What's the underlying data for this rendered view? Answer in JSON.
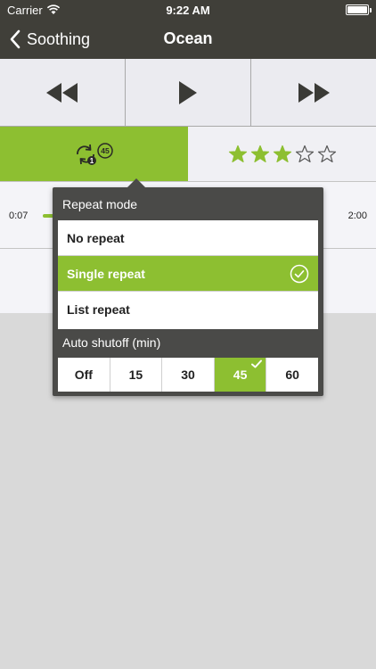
{
  "status": {
    "carrier": "Carrier",
    "time": "9:22 AM"
  },
  "nav": {
    "back_label": "Soothing",
    "title": "Ocean"
  },
  "controls": {
    "icons": [
      "rewind-icon",
      "play-icon",
      "fast-forward-icon"
    ]
  },
  "repeat": {
    "single_badge": "1",
    "minutes_badge": "45"
  },
  "rating": {
    "value": 3,
    "max": 5
  },
  "progress": {
    "elapsed": "0:07",
    "total": "2:00"
  },
  "popover": {
    "repeat_title": "Repeat mode",
    "modes": [
      {
        "label": "No repeat",
        "selected": false
      },
      {
        "label": "Single repeat",
        "selected": true
      },
      {
        "label": "List repeat",
        "selected": false
      }
    ],
    "shutoff_title": "Auto shutoff (min)",
    "shutoff_options": [
      {
        "label": "Off",
        "selected": false
      },
      {
        "label": "15",
        "selected": false
      },
      {
        "label": "30",
        "selected": false
      },
      {
        "label": "45",
        "selected": true
      },
      {
        "label": "60",
        "selected": false
      }
    ]
  },
  "colors": {
    "accent": "#8dbf31",
    "navbar": "#403f39",
    "popover": "#4a4a48"
  }
}
